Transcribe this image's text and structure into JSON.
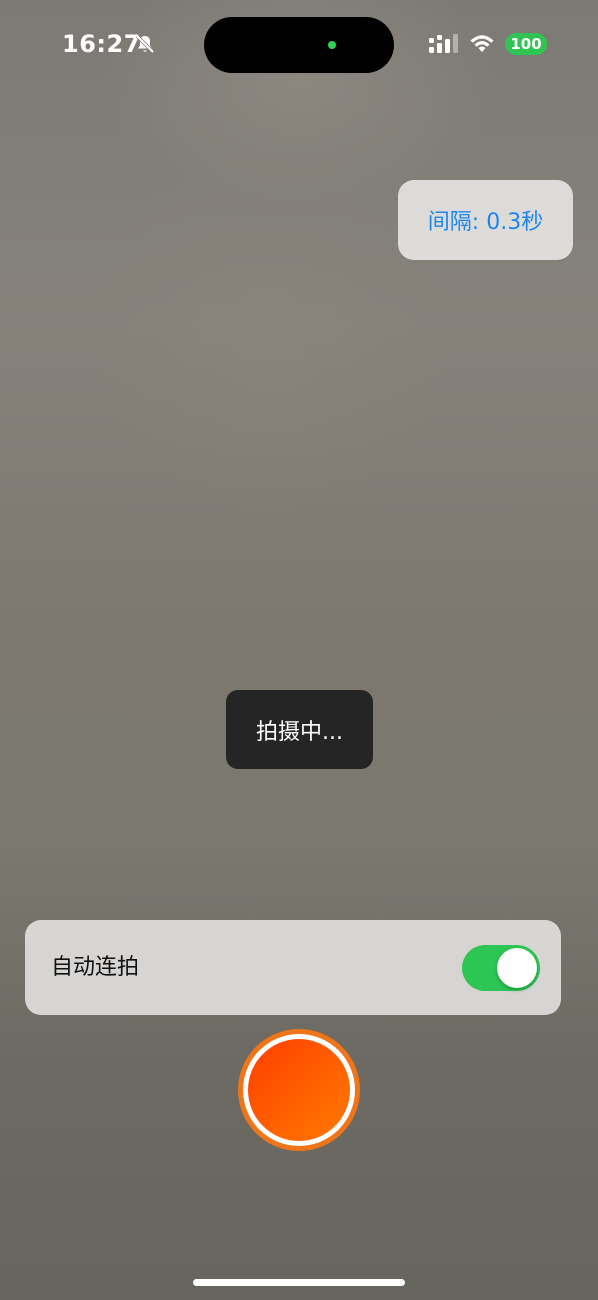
{
  "status_bar": {
    "time": "16:27",
    "battery": "100",
    "icons": [
      "bell-off-icon",
      "signal-icon",
      "wifi-icon"
    ],
    "battery_color": "#30c552",
    "privacy_dot_color": "#2fd158"
  },
  "interval": {
    "label": "间隔: 0.3秒",
    "color": "#1c86ec"
  },
  "toast": {
    "text": "拍摄中..."
  },
  "auto_burst": {
    "label": "自动连拍",
    "enabled": true,
    "toggle_color": "#2cc654"
  },
  "shutter": {
    "color": "#ff5a00"
  }
}
